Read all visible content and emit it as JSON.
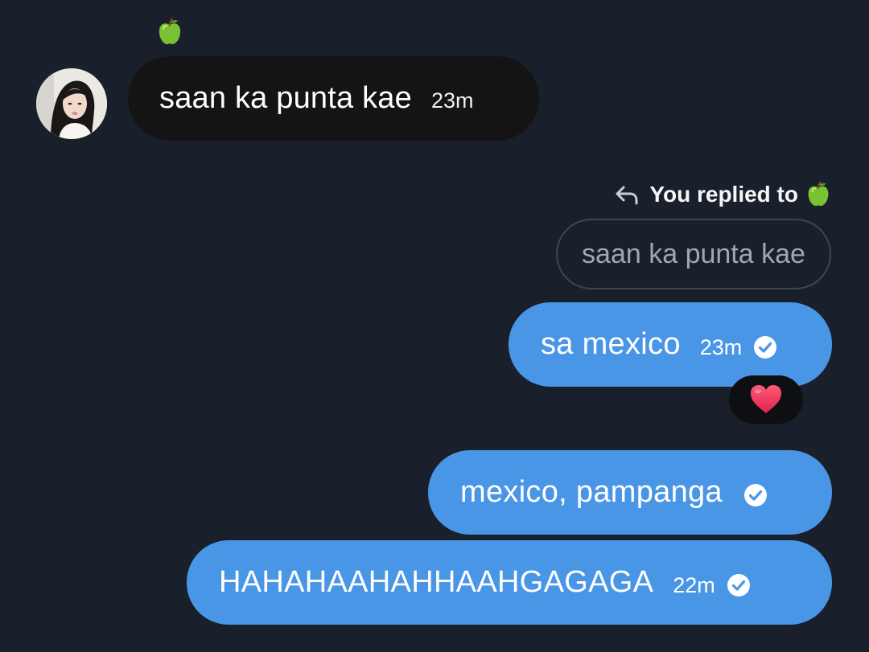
{
  "incoming": {
    "sender_emoji": "green-apple-icon",
    "text": "saan ka punta kae",
    "time": "23m"
  },
  "reply_context": {
    "label": "You replied to",
    "to_emoji": "green-apple-icon",
    "quoted_text": "saan ka punta kae"
  },
  "outgoing": [
    {
      "text": "sa mexico",
      "time": "23m",
      "status": "sent-check-icon",
      "reaction": "red-heart-icon"
    },
    {
      "text": "mexico, pampanga",
      "time": "",
      "status": "sent-check-icon"
    },
    {
      "text": "HAHAHAAHAHHAAHGAGAGA",
      "time": "22m",
      "status": "sent-check-icon"
    }
  ],
  "colors": {
    "background": "#19202b",
    "incoming_bubble": "#141414",
    "outgoing_bubble": "#4a96e6",
    "quoted_border": "#3f4650",
    "quoted_text": "#a1a7b0",
    "reaction_bg": "#0d0f12"
  }
}
